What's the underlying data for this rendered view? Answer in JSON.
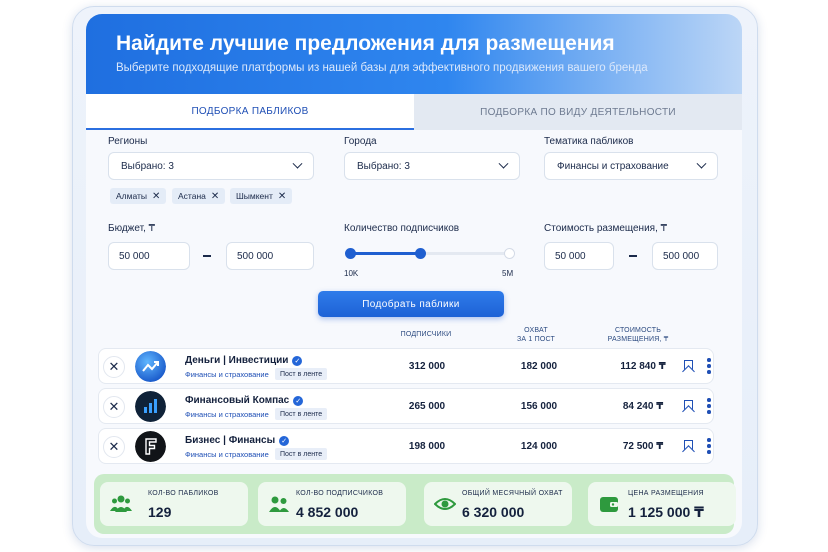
{
  "header": {
    "title": "Найдите лучшие предложения для размещения",
    "subtitle": "Выберите подходящие платформы из нашей базы для эффективного продвижения вашего бренда"
  },
  "tabs": [
    {
      "label": "ПОДБОРКА ПАБЛИКОВ",
      "active": true
    },
    {
      "label": "ПОДБОРКА ПО ВИДУ ДЕЯТЕЛЬНОСТИ",
      "active": false
    }
  ],
  "filters": {
    "regions": {
      "label": "Регионы",
      "value": "Выбрано: 3",
      "chips": [
        "Алматы",
        "Астана",
        "Шымкент"
      ]
    },
    "cities": {
      "label": "Города",
      "value": "Выбрано: 3"
    },
    "topic": {
      "label": "Тематика пабликов",
      "value": "Финансы и страхование"
    },
    "budget": {
      "label": "Бюджет, ₸",
      "from": "50 000",
      "to": "500 000"
    },
    "followers": {
      "label": "Количество подписчиков",
      "min_label": "10K",
      "max_label": "5M",
      "level_fraction": 0.44
    },
    "cost": {
      "label": "Стоимость размещения, ₸",
      "from": "50 000",
      "to": "500 000"
    }
  },
  "search_button": "Подобрать паблики",
  "columns": {
    "subscribers": "ПОДПИСЧИКИ",
    "reach_line1": "ОХВАТ",
    "reach_line2": "ЗА 1 ПОСТ",
    "cost_line1": "СТОИМОСТЬ",
    "cost_line2": "РАЗМЕЩЕНИЯ, ₸"
  },
  "rows": [
    {
      "name": "Деньги | Инвестиции",
      "category": "Финансы и страхование",
      "badge": "Пост в ленте",
      "subscribers": "312 000",
      "reach": "182 000",
      "cost": "112 840 ₸"
    },
    {
      "name": "Финансовый Компас",
      "category": "Финансы и страхование",
      "badge": "Пост в ленте",
      "subscribers": "265 000",
      "reach": "156 000",
      "cost": "84 240 ₸"
    },
    {
      "name": "Бизнес | Финансы",
      "category": "Финансы и страхование",
      "badge": "Пост в ленте",
      "subscribers": "198 000",
      "reach": "124 000",
      "cost": "72 500 ₸"
    }
  ],
  "stats": [
    {
      "label": "КОЛ-ВО ПАБЛИКОВ",
      "value": "129",
      "icon": "users-icon"
    },
    {
      "label": "КОЛ-ВО ПОДПИСЧИКОВ",
      "value": "4 852 000",
      "icon": "people-icon"
    },
    {
      "label": "ОБЩИЙ МЕСЯЧНЫЙ ОХВАТ",
      "value": "6 320 000",
      "icon": "eye-icon"
    },
    {
      "label": "ЦЕНА РАЗМЕЩЕНИЯ",
      "value": "1 125 000 ₸",
      "icon": "wallet-icon"
    }
  ],
  "colors": {
    "accent": "#1f5fd0",
    "stats_bg": "#c9ebc8",
    "icon_green": "#2e9a3e"
  }
}
